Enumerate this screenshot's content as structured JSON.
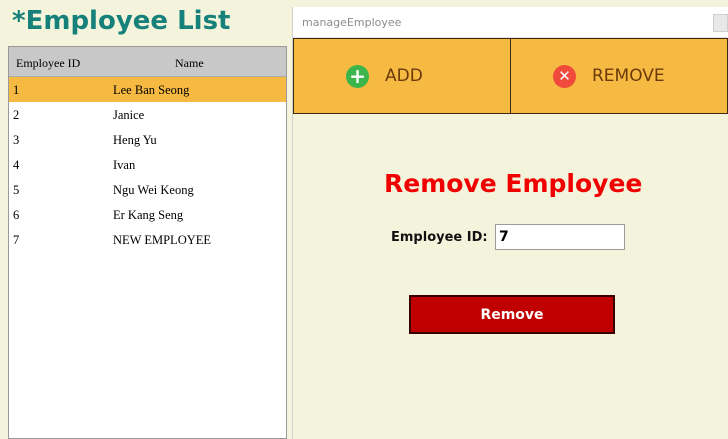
{
  "left": {
    "title": "*Employee List",
    "columns": {
      "id": "Employee ID",
      "name": "Name"
    },
    "rows": [
      {
        "id": "1",
        "name": "Lee Ban Seong"
      },
      {
        "id": "2",
        "name": "Janice"
      },
      {
        "id": "3",
        "name": "Heng Yu"
      },
      {
        "id": "4",
        "name": "Ivan"
      },
      {
        "id": "5",
        "name": "Ngu Wei Keong"
      },
      {
        "id": "6",
        "name": "Er Kang Seng"
      },
      {
        "id": "7",
        "name": "NEW EMPLOYEE"
      }
    ],
    "selected_row": 0
  },
  "window": {
    "title": "manageEmployee",
    "tabs": {
      "add": {
        "label": "ADD",
        "icon": "plus-circle-icon",
        "color": "#3cb54a"
      },
      "remove": {
        "label": "REMOVE",
        "icon": "x-circle-icon",
        "color": "#ef4a3c"
      }
    },
    "form": {
      "title": "Remove Employee",
      "id_label": "Employee ID:",
      "id_value": "7",
      "button_label": "Remove"
    }
  },
  "colors": {
    "accent": "#f6b942",
    "title_teal": "#15817a",
    "danger": "#c00000",
    "background": "#f4f4dc"
  }
}
